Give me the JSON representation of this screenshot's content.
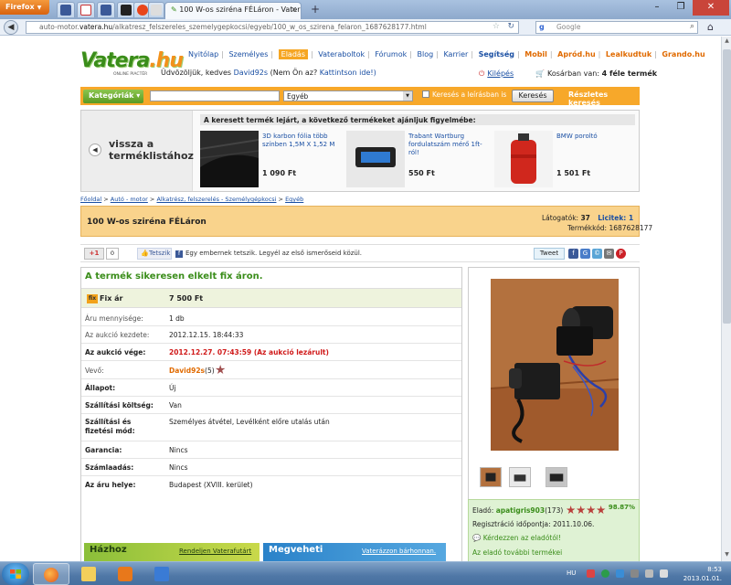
{
  "browser": {
    "menu_label": "Firefox",
    "tab_title": "100 W-os sziréna FÉLáron - Vatera.hu",
    "url_prefix": "auto-motor.",
    "url_host": "vatera.hu",
    "url_path": "/alkatresz_felszereles_szemelygepkocsi/egyeb/100_w_os_szirena_felaron_1687628177.html",
    "search_placeholder": "Google",
    "search_engine_label": "g"
  },
  "site": {
    "logo_word": "Vatera",
    "logo_dot": ".hu",
    "logo_sub": "ONLINE PIACTÉR",
    "nav": [
      "Nyitólap",
      "Személyes",
      "Eladás",
      "Vateraboltok",
      "Fórumok",
      "Blog",
      "Karrier",
      "Segítség",
      "Mobil",
      "Apród.hu",
      "Lealkudtuk",
      "Grando.hu"
    ],
    "welcome_prefix": "Üdvözöljük, kedves",
    "welcome_user": "David92s",
    "welcome_q": "(Nem Ön az?",
    "welcome_link": "Kattintson ide!)",
    "logout": "Kilépés",
    "cart_prefix": "Kosárban van:",
    "cart_count": "4 féle termék",
    "categories_btn": "Kategóriák",
    "category_value": "Egyéb",
    "desc_search": "Keresés a leírásban is",
    "search_btn": "Keresés",
    "advanced_search": "Részletes keresés"
  },
  "ended": {
    "back_label_1": "vissza a",
    "back_label_2": "terméklistához",
    "title": "A keresett termék lejárt, a következő termékeket ajánljuk figyelmébe:",
    "items": [
      {
        "name": "3D karbon fólia több színben 1,5M X 1,52 M",
        "price": "1 090 Ft"
      },
      {
        "name": "Trabant Wartburg fordulatszám mérő 1ft-ról!",
        "price": "550 Ft"
      },
      {
        "name": "BMW poroltó",
        "price": "1 501 Ft"
      }
    ]
  },
  "breadcrumb": [
    "Főoldal",
    "Autó - motor",
    "Alkatrész, felszerelés - Személygépkocsi",
    "Egyéb"
  ],
  "item": {
    "title": "100 W-os sziréna FÉLáron",
    "visitors_label": "Látogatók:",
    "visitors": "37",
    "bids_label": "Licitek:",
    "bids": "1",
    "item_no_label": "Termékkód:",
    "item_no": "1687628177"
  },
  "social": {
    "gplus": "+1",
    "gplus_count": "0",
    "like": "Tetszik",
    "fb_text": "Egy embernek tetszik. Legyél az első ismerőseid közül.",
    "tweet": "Tweet"
  },
  "sale": {
    "headline": "A termék sikeresen elkelt fix áron.",
    "fix_badge": "fix",
    "fix_label": "Fix ár",
    "fix_value": "7 500 Ft",
    "rows": [
      {
        "label": "Áru mennyisége:",
        "value": "1 db"
      },
      {
        "label": "Az aukció kezdete:",
        "value": "2012.12.15. 18:44:33"
      },
      {
        "label": "Az aukció vége:",
        "value": "2012.12.27. 07:43:59 (Az aukció lezárult)"
      },
      {
        "label": "Vevő:",
        "value": "David92s",
        "extra": "(5)"
      },
      {
        "label": "Állapot:",
        "value": "Új"
      },
      {
        "label": "Szállítási költség:",
        "value": "Van"
      },
      {
        "label": "Szállítási és fizetési mód:",
        "value": "Személyes átvétel, Levélként előre utalás után"
      },
      {
        "label": "Garancia:",
        "value": "Nincs"
      },
      {
        "label": "Számlaadás:",
        "value": "Nincs"
      },
      {
        "label": "Az áru helye:",
        "value": "Budapest (XVIII. kerület)"
      }
    ]
  },
  "seller": {
    "label": "Eladó:",
    "name": "apatigris903",
    "score": "(173)",
    "percent": "98.87%",
    "reg_label": "Regisztráció időpontja:",
    "reg_date": "2011.10.06.",
    "ask": "Kérdezzen az eladótól!",
    "more": "Az eladó további termékei"
  },
  "banners": {
    "b1_title": "Házhoz",
    "b1_sub": "Rendeljen Vaterafutárt",
    "b2_title": "Megveheti",
    "b2_sub": "Vaterázzon bárhonnan."
  },
  "taskbar": {
    "lang": "HU",
    "time": "8:53",
    "date": "2013.01.01."
  },
  "colors": {
    "accent_orange": "#f7a82a",
    "brand_green": "#3a8d1a",
    "sold_red": "#d01a1a"
  }
}
